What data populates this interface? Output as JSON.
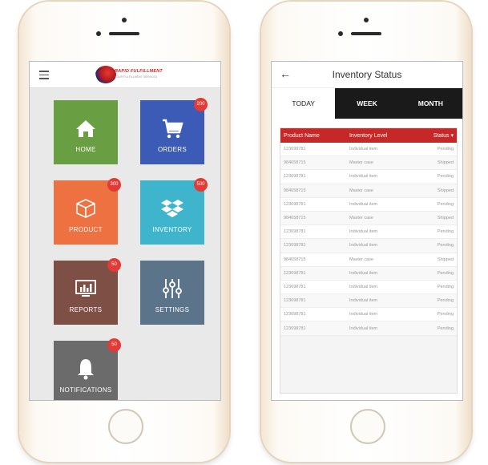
{
  "left_phone": {
    "logo": {
      "title": "RAPID FULFILLMENT",
      "subtitle": "YOUR FULFILLMENT SERVICES"
    },
    "tiles": [
      {
        "label": "HOME",
        "badge": "",
        "color": "#6a9e42"
      },
      {
        "label": "ORDERS",
        "badge": "200",
        "color": "#3b5bb6"
      },
      {
        "label": "PRODUCT",
        "badge": "300",
        "color": "#ee7241"
      },
      {
        "label": "INVENTORY",
        "badge": "500",
        "color": "#3fb5cd"
      },
      {
        "label": "REPORTS",
        "badge": "50",
        "color": "#7e4f45"
      },
      {
        "label": "SETTINGS",
        "badge": "",
        "color": "#5c7489"
      },
      {
        "label": "NOTIFICATIONS",
        "badge": "50",
        "color": "#6b6b6b"
      }
    ]
  },
  "right_phone": {
    "title": "Inventory Status",
    "tabs": [
      "TODAY",
      "WEEK",
      "MONTH"
    ],
    "table": {
      "headers": [
        "Product Name",
        "Inventory Level",
        "Status ▾"
      ],
      "rows": [
        [
          "123698781",
          "Individual item",
          "Pending"
        ],
        [
          "984658715",
          "Master case",
          "Shipped"
        ],
        [
          "123698781",
          "Individual item",
          "Pending"
        ],
        [
          "984658715",
          "Master case",
          "Shipped"
        ],
        [
          "123698781",
          "Individual item",
          "Pending"
        ],
        [
          "984658715",
          "Master case",
          "Shipped"
        ],
        [
          "123698781",
          "Individual item",
          "Pending"
        ],
        [
          "123698781",
          "Individual item",
          "Pending"
        ],
        [
          "984658715",
          "Master case",
          "Shipped"
        ],
        [
          "123698781",
          "Individual item",
          "Pending"
        ],
        [
          "123698781",
          "Individual item",
          "Pending"
        ],
        [
          "123698781",
          "Individual item",
          "Pending"
        ],
        [
          "123698781",
          "Individual item",
          "Pending"
        ],
        [
          "123698781",
          "Individual item",
          "Pending"
        ]
      ]
    },
    "accent_color": "#c62828"
  }
}
